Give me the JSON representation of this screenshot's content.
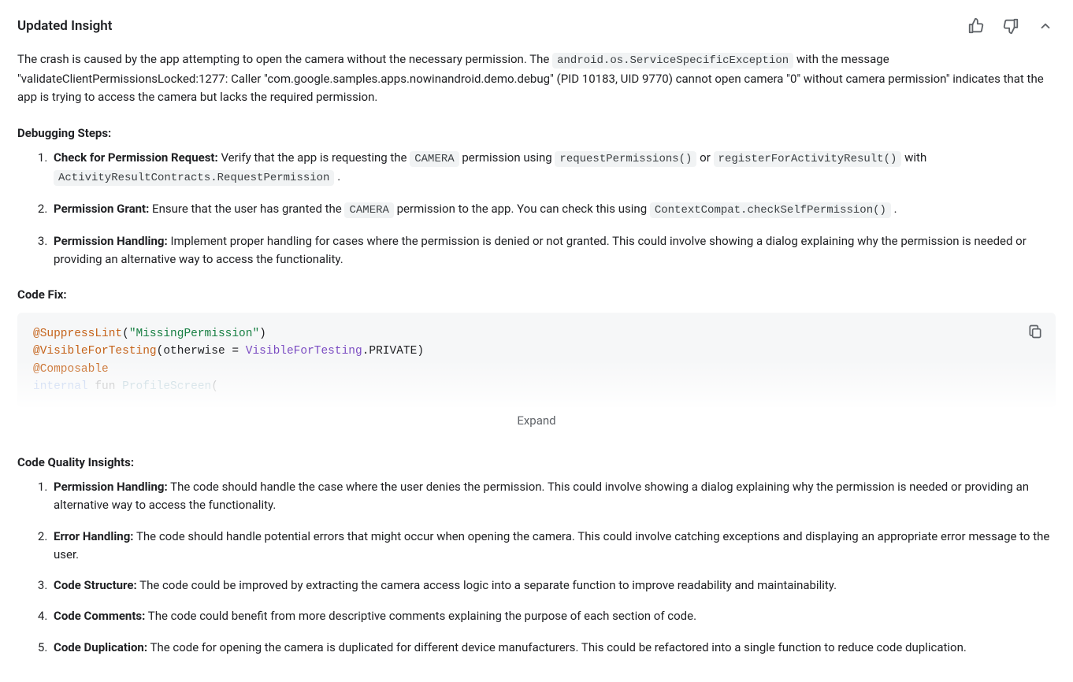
{
  "title": "Updated Insight",
  "intro": {
    "p1a": "The crash is caused by the app attempting to open the camera without the necessary permission. The ",
    "code1": "android.os.ServiceSpecificException",
    "p1b": " with the message \"validateClientPermissionsLocked:1277: Caller \"com.google.samples.apps.nowinandroid.demo.debug\" (PID 10183, UID 9770) cannot open camera \"0\" without camera permission\" indicates that the app is trying to access the camera but lacks the required permission."
  },
  "debug_head": "Debugging Steps:",
  "steps": [
    {
      "lead": "Check for Permission Request:",
      "t1": " Verify that the app is requesting the ",
      "c1": "CAMERA",
      "t2": " permission using ",
      "c2": "requestPermissions()",
      "t3": " or ",
      "c3": "registerForActivityResult()",
      "t4": " with ",
      "c4": "ActivityResultContracts.RequestPermission",
      "t5": " ."
    },
    {
      "lead": "Permission Grant:",
      "t1": " Ensure that the user has granted the ",
      "c1": "CAMERA",
      "t2": " permission to the app. You can check this using ",
      "c2": "ContextCompat.checkSelfPermission()",
      "t3": " ."
    },
    {
      "lead": "Permission Handling:",
      "t1": " Implement proper handling for cases where the permission is denied or not granted. This could involve showing a dialog explaining why the permission is needed or providing an alternative way to access the functionality."
    }
  ],
  "codefix_head": "Code Fix:",
  "code": {
    "l1a": "@SuppressLint",
    "l1b": "(",
    "l1c": "\"MissingPermission\"",
    "l1d": ")",
    "l2a": "@VisibleForTesting",
    "l2b": "(otherwise = ",
    "l2c": "VisibleForTesting",
    "l2d": ".PRIVATE)",
    "l3a": "@Composable",
    "l4a": "internal",
    "l4b": " fun ",
    "l4c": "ProfileScreen",
    "l4d": "("
  },
  "expand_label": "Expand",
  "quality_head": "Code Quality Insights:",
  "quality": [
    {
      "lead": "Permission Handling:",
      "text": " The code should handle the case where the user denies the permission. This could involve showing a dialog explaining why the permission is needed or providing an alternative way to access the functionality."
    },
    {
      "lead": "Error Handling:",
      "text": " The code should handle potential errors that might occur when opening the camera. This could involve catching exceptions and displaying an appropriate error message to the user."
    },
    {
      "lead": "Code Structure:",
      "text": " The code could be improved by extracting the camera access logic into a separate function to improve readability and maintainability."
    },
    {
      "lead": "Code Comments:",
      "text": " The code could benefit from more descriptive comments explaining the purpose of each section of code."
    },
    {
      "lead": "Code Duplication:",
      "text": " The code for opening the camera is duplicated for different device manufacturers. This could be refactored into a single function to reduce code duplication."
    }
  ]
}
